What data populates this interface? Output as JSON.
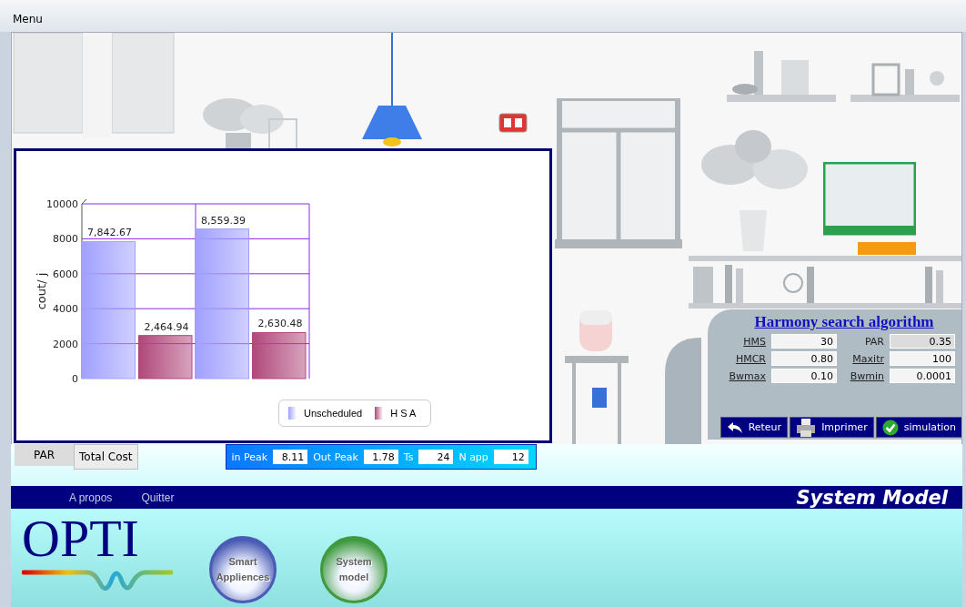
{
  "menu_bar": {
    "label": "Menu"
  },
  "chart_panel": {
    "chart_data": {
      "type": "bar",
      "ylabel": "cout/ j",
      "ylim": [
        0,
        10000
      ],
      "yticks": [
        0,
        2000,
        4000,
        6000,
        8000,
        10000
      ],
      "grid": true,
      "value_labels": [
        [
          "7,842.67",
          "8,559.39"
        ],
        [
          "2,464.94",
          "2,630.48"
        ]
      ],
      "series": [
        {
          "name": "Unscheduled",
          "color": "#a0a0ff",
          "values": [
            7842.67,
            8559.39
          ]
        },
        {
          "name": "H S A",
          "color": "#b0487a",
          "values": [
            2464.94,
            2630.48
          ]
        }
      ]
    }
  },
  "harmony_panel": {
    "title": "Harmony search algorithm",
    "fields": [
      {
        "label": "HMS",
        "value": "30",
        "disabled": false
      },
      {
        "label": "PAR",
        "value": "0.35",
        "disabled": true
      },
      {
        "label": "HMCR",
        "value": "0.80",
        "disabled": false
      },
      {
        "label": "Maxitr",
        "value": "100",
        "disabled": false
      },
      {
        "label": "Bwmax",
        "value": "0.10",
        "disabled": false
      },
      {
        "label": "Bwmin",
        "value": "0.0001",
        "disabled": false
      }
    ],
    "buttons": [
      {
        "kind": "back",
        "label": "Reteur"
      },
      {
        "kind": "print",
        "label": "Imprimer"
      },
      {
        "kind": "check",
        "label": "simulation"
      }
    ]
  },
  "tabs": [
    {
      "label": "PAR",
      "selected": false
    },
    {
      "label": "Total Cost",
      "selected": true
    }
  ],
  "params": [
    {
      "label": "in Peak",
      "value": "8.11"
    },
    {
      "label": "Out Peak",
      "value": "1.78"
    },
    {
      "label": "Ts",
      "value": "24"
    },
    {
      "label": "N app",
      "value": "12"
    }
  ],
  "nav_bar": {
    "links": [
      "A propos",
      "Quitter"
    ],
    "title": "System Model"
  },
  "logo": {
    "text": "OPTI"
  },
  "orb_buttons": [
    {
      "label": "Smart Appliences",
      "color": "#4a5bb5"
    },
    {
      "label": "System model",
      "color": "#3f9a3f"
    }
  ]
}
